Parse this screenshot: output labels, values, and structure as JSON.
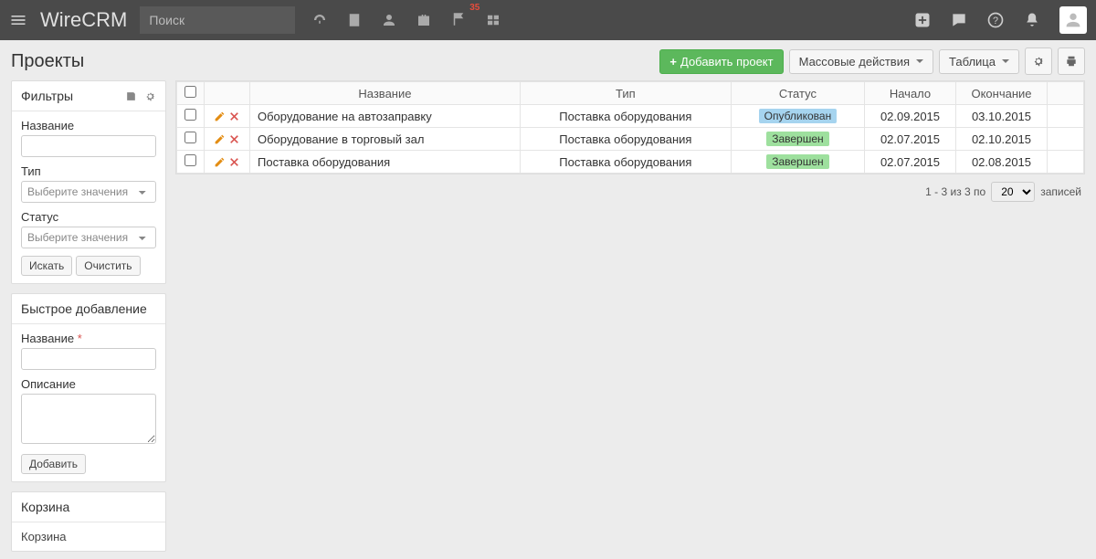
{
  "topbar": {
    "brand": "WireCRM",
    "search_placeholder": "Поиск",
    "flag_badge": "35"
  },
  "page": {
    "title": "Проекты",
    "add_button": "Добавить проект",
    "bulk_actions": "Массовые действия",
    "view_mode": "Таблица"
  },
  "filters": {
    "title": "Фильтры",
    "name_label": "Название",
    "type_label": "Тип",
    "type_placeholder": "Выберите значения",
    "status_label": "Статус",
    "status_placeholder": "Выберите значения",
    "search_btn": "Искать",
    "clear_btn": "Очистить"
  },
  "quickadd": {
    "title": "Быстрое добавление",
    "name_label": "Название",
    "desc_label": "Описание",
    "add_btn": "Добавить"
  },
  "trash": {
    "title": "Корзина",
    "link": "Корзина"
  },
  "table": {
    "columns": {
      "name": "Название",
      "type": "Тип",
      "status": "Статус",
      "start": "Начало",
      "end": "Окончание"
    },
    "rows": [
      {
        "name": "Оборудование на автозаправку",
        "type": "Поставка оборудования",
        "status": "Опубликован",
        "status_class": "status-blue",
        "start": "02.09.2015",
        "end": "03.10.2015"
      },
      {
        "name": "Оборудование в торговый зал",
        "type": "Поставка оборудования",
        "status": "Завершен",
        "status_class": "status-green",
        "start": "02.07.2015",
        "end": "02.10.2015"
      },
      {
        "name": "Поставка оборудования",
        "type": "Поставка оборудования",
        "status": "Завершен",
        "status_class": "status-green",
        "start": "02.07.2015",
        "end": "02.08.2015"
      }
    ]
  },
  "pager": {
    "text": "1 - 3 из 3 по",
    "page_size": "20",
    "suffix": "записей"
  }
}
